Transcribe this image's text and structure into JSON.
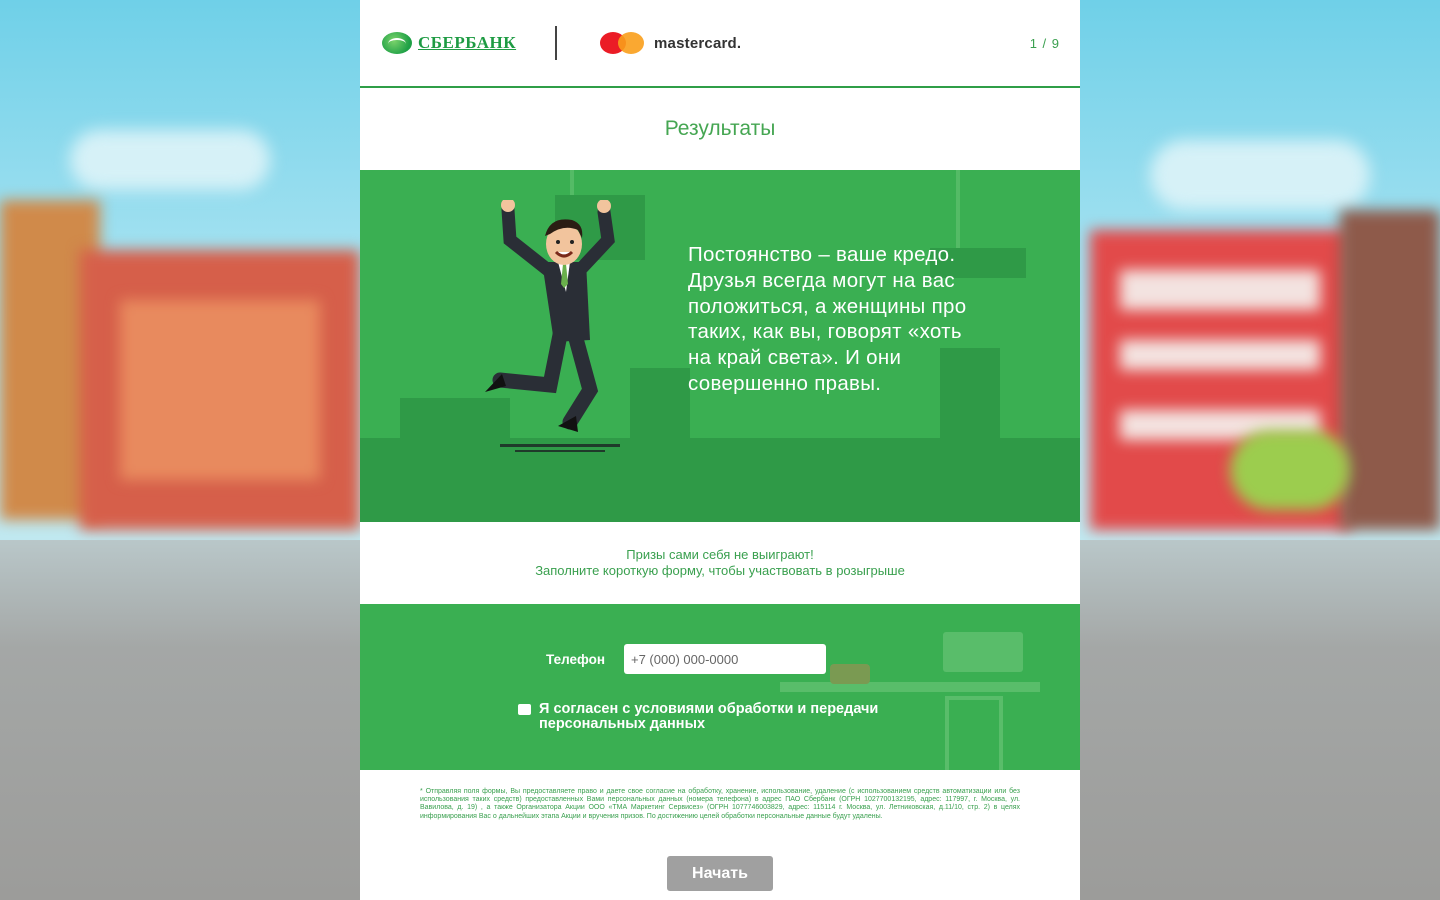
{
  "header": {
    "bank_name": "СБЕРБАНК",
    "partner_name": "mastercard.",
    "progress": "1 / 9"
  },
  "title": "Результаты",
  "result_text": "Постоянство – ваше кредо. Друзья всегда могут на вас положиться, а женщины про таких, как вы, говорят «хоть на край света». И они совершенно правы.",
  "cta": {
    "line1": "Призы сами себя не выиграют!",
    "line2": "Заполните короткую форму, чтобы участвовать в розыгрыше"
  },
  "form": {
    "phone_label": "Телефон",
    "phone_placeholder": "+7 (000) 000-0000",
    "phone_value": "",
    "consent_checked": false,
    "consent_label": "Я согласен с условиями обработки и передачи персональных данных"
  },
  "legal_text": "* Отправляя поля формы, Вы предоставляете право и даете свое согласие на обработку, хранение, использование, удаление (с использованием средств автоматизации или без использования таких средств) предоставленных Вами персональных данных (номера телефона) в адрес ПАО Сбербанк (ОГРН 1027700132195, адрес: 117997, г. Москва, ул. Вавилова, д. 19) , а также Организатора Акции ООО «ТМА Маркетинг Сервисез» (ОГРН 1077746003829, адрес: 115114 г. Москва, ул. Летниковская, д.11/10, стр. 2) в целях информирования Вас о дальнейших этапа Акции и вручения призов. По достижению целей обработки персональные данные будут удалены.",
  "start_button": "Начать",
  "colors": {
    "brand_green": "#3aaf52",
    "text_green": "#3aa04f",
    "button_gray": "#a0a0a0"
  },
  "icons": {
    "bank_logo": "sberbank-logo",
    "partner_logo": "mastercard-logo",
    "illustration": "jumping-businessman"
  }
}
